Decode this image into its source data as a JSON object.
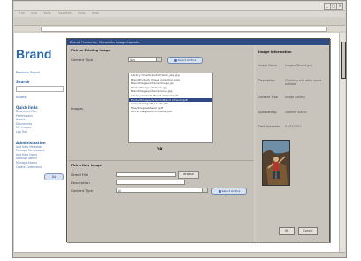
{
  "browser": {
    "window_title": "",
    "menu": [
      "File",
      "Edit",
      "View",
      "Favorites",
      "Tools",
      "Help"
    ]
  },
  "site": {
    "brand": "Brand",
    "nav_top": "Products  Brand",
    "search_label": "Search",
    "nav_link": "Assets",
    "quick_links_heading": "Quick links",
    "quick_links": [
      "Download Files",
      "Permissions",
      "Assets",
      "Documents",
      "My Images",
      "Log Out"
    ],
    "admin_heading": "Administration",
    "admin_links": [
      "Add New Metadata",
      "Manage Permissions",
      "Add New Users",
      "Settings Admin",
      "Manage Assets",
      "Create Collections"
    ],
    "admin_button": "Go"
  },
  "dialog": {
    "title": "Brand Products - Metadata Image Update",
    "existing_section": "Pick an Existing Image",
    "content_type_label": "Content Type",
    "content_type_value": "Any",
    "select_button": "Select All Pics",
    "images_label": "Images",
    "images": [
      "Library Smartbrand Artwork_pkg.jpg",
      "BrandProducts Image Collection.pjpg",
      "BrandImages/Artwork/image.jpg",
      "ProductImages/Artwork.jpg",
      "BrandImages/Artwork/Logo.jpg",
      "Library Products Brand Artwork.pdf",
      "ProductImages/Artwork/Brand Artwork/pdf",
      "ArtworkImagesProducts.pdf",
      "Files/ImagesArtwork.pdf",
      "Office Images/Office Media.pdf"
    ],
    "selected_image_index": 6,
    "or_label": "OR",
    "upload_section": "Pick a New Image",
    "select_file_label": "Select File",
    "select_file_value": "",
    "browse_button": "Browse",
    "description_label": "Description",
    "description_value": "",
    "content_type2_label": "Content Type",
    "content_type2_value": "All",
    "select_button2": "Select All Pics",
    "ok_button": "OK",
    "cancel_button": "Cancel"
  },
  "image_info": {
    "heading": "Image Information",
    "fields": [
      {
        "key": "Image Name",
        "value": "ImageofDesert.jpg"
      },
      {
        "key": "Description",
        "value": "Climbing and other sport outdoor"
      },
      {
        "key": "Content Type",
        "value": "Image Gallery"
      },
      {
        "key": "Uploaded By",
        "value": "Graeme Admin"
      },
      {
        "key": "Date Uploaded",
        "value": "01/05/2011"
      }
    ]
  },
  "colors": {
    "brand": "#2a66a8",
    "dialog_title_bar": "#2d4a85",
    "selection": "#2d4a85",
    "dialog_bg": "#cfcbc2"
  }
}
